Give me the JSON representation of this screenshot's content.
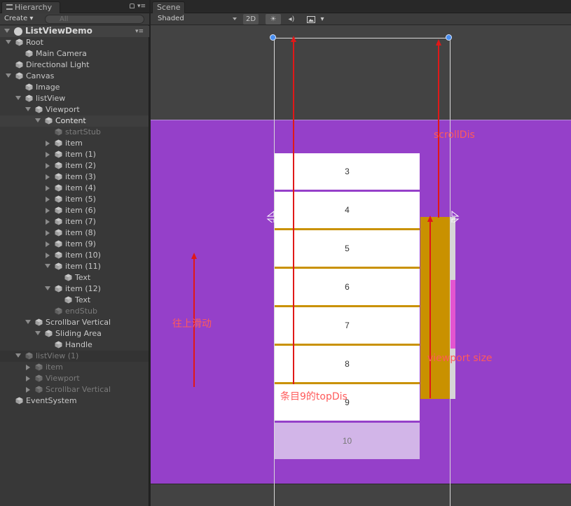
{
  "hierarchy": {
    "tab_label": "Hierarchy",
    "create_label": "Create",
    "search_placeholder": "All",
    "scene_name": "ListViewDemo",
    "rows": [
      {
        "label": "Root",
        "depth": 1,
        "arrow": "down",
        "style": "normal"
      },
      {
        "label": "Main Camera",
        "depth": 2,
        "arrow": "none",
        "style": "normal"
      },
      {
        "label": "Directional Light",
        "depth": 1,
        "arrow": "none",
        "style": "normal"
      },
      {
        "label": "Canvas",
        "depth": 1,
        "arrow": "down",
        "style": "normal"
      },
      {
        "label": "Image",
        "depth": 2,
        "arrow": "none",
        "style": "normal"
      },
      {
        "label": "listView",
        "depth": 2,
        "arrow": "down",
        "style": "normal"
      },
      {
        "label": "Viewport",
        "depth": 3,
        "arrow": "down",
        "style": "normal"
      },
      {
        "label": "Content",
        "depth": 4,
        "arrow": "down",
        "style": "selected"
      },
      {
        "label": "startStub",
        "depth": 5,
        "arrow": "none",
        "style": "dim"
      },
      {
        "label": "item",
        "depth": 5,
        "arrow": "right",
        "style": "normal"
      },
      {
        "label": "item (1)",
        "depth": 5,
        "arrow": "right",
        "style": "normal"
      },
      {
        "label": "item (2)",
        "depth": 5,
        "arrow": "right",
        "style": "normal"
      },
      {
        "label": "item (3)",
        "depth": 5,
        "arrow": "right",
        "style": "normal"
      },
      {
        "label": "item (4)",
        "depth": 5,
        "arrow": "right",
        "style": "normal"
      },
      {
        "label": "item (5)",
        "depth": 5,
        "arrow": "right",
        "style": "normal"
      },
      {
        "label": "item (6)",
        "depth": 5,
        "arrow": "right",
        "style": "normal"
      },
      {
        "label": "item (7)",
        "depth": 5,
        "arrow": "right",
        "style": "normal"
      },
      {
        "label": "item (8)",
        "depth": 5,
        "arrow": "right",
        "style": "normal"
      },
      {
        "label": "item (9)",
        "depth": 5,
        "arrow": "right",
        "style": "normal"
      },
      {
        "label": "item (10)",
        "depth": 5,
        "arrow": "right",
        "style": "normal"
      },
      {
        "label": "item (11)",
        "depth": 5,
        "arrow": "down",
        "style": "normal"
      },
      {
        "label": "Text",
        "depth": 6,
        "arrow": "none",
        "style": "normal"
      },
      {
        "label": "item (12)",
        "depth": 5,
        "arrow": "down",
        "style": "normal"
      },
      {
        "label": "Text",
        "depth": 6,
        "arrow": "none",
        "style": "normal"
      },
      {
        "label": "endStub",
        "depth": 5,
        "arrow": "none",
        "style": "dim"
      },
      {
        "label": "Scrollbar Vertical",
        "depth": 3,
        "arrow": "down",
        "style": "normal"
      },
      {
        "label": "Sliding Area",
        "depth": 4,
        "arrow": "down",
        "style": "normal"
      },
      {
        "label": "Handle",
        "depth": 5,
        "arrow": "none",
        "style": "normal"
      },
      {
        "label": "listView (1)",
        "depth": 2,
        "arrow": "down",
        "style": "dim-alt"
      },
      {
        "label": "item",
        "depth": 3,
        "arrow": "right",
        "style": "dim"
      },
      {
        "label": "Viewport",
        "depth": 3,
        "arrow": "right",
        "style": "dim"
      },
      {
        "label": "Scrollbar Vertical",
        "depth": 3,
        "arrow": "right",
        "style": "dim"
      },
      {
        "label": "EventSystem",
        "depth": 1,
        "arrow": "none",
        "style": "normal"
      }
    ]
  },
  "scene": {
    "tab_label": "Scene",
    "shading_mode": "Shaded",
    "mode_2d_label": "2D",
    "toolbar_icons": [
      "sun-icon",
      "audio-icon",
      "image-icon"
    ],
    "items": [
      {
        "label": "3",
        "faded": false
      },
      {
        "label": "4",
        "faded": false
      },
      {
        "label": "5",
        "faded": false
      },
      {
        "label": "6",
        "faded": false
      },
      {
        "label": "7",
        "faded": false
      },
      {
        "label": "8",
        "faded": false
      },
      {
        "label": "9",
        "faded": false
      },
      {
        "label": "10",
        "faded": true
      }
    ],
    "annotations": {
      "scroll_dis": "scrollDis",
      "swipe_up": "往上滑动",
      "viewport_size": "viewport size",
      "item9_top_dis": "条目9的topDis"
    },
    "colors": {
      "canvas_purple": "#9540c9",
      "scrollbar_gold": "#c99100",
      "scroll_handle": "#e455d0",
      "annotation_red": "#ff5a5a"
    }
  }
}
